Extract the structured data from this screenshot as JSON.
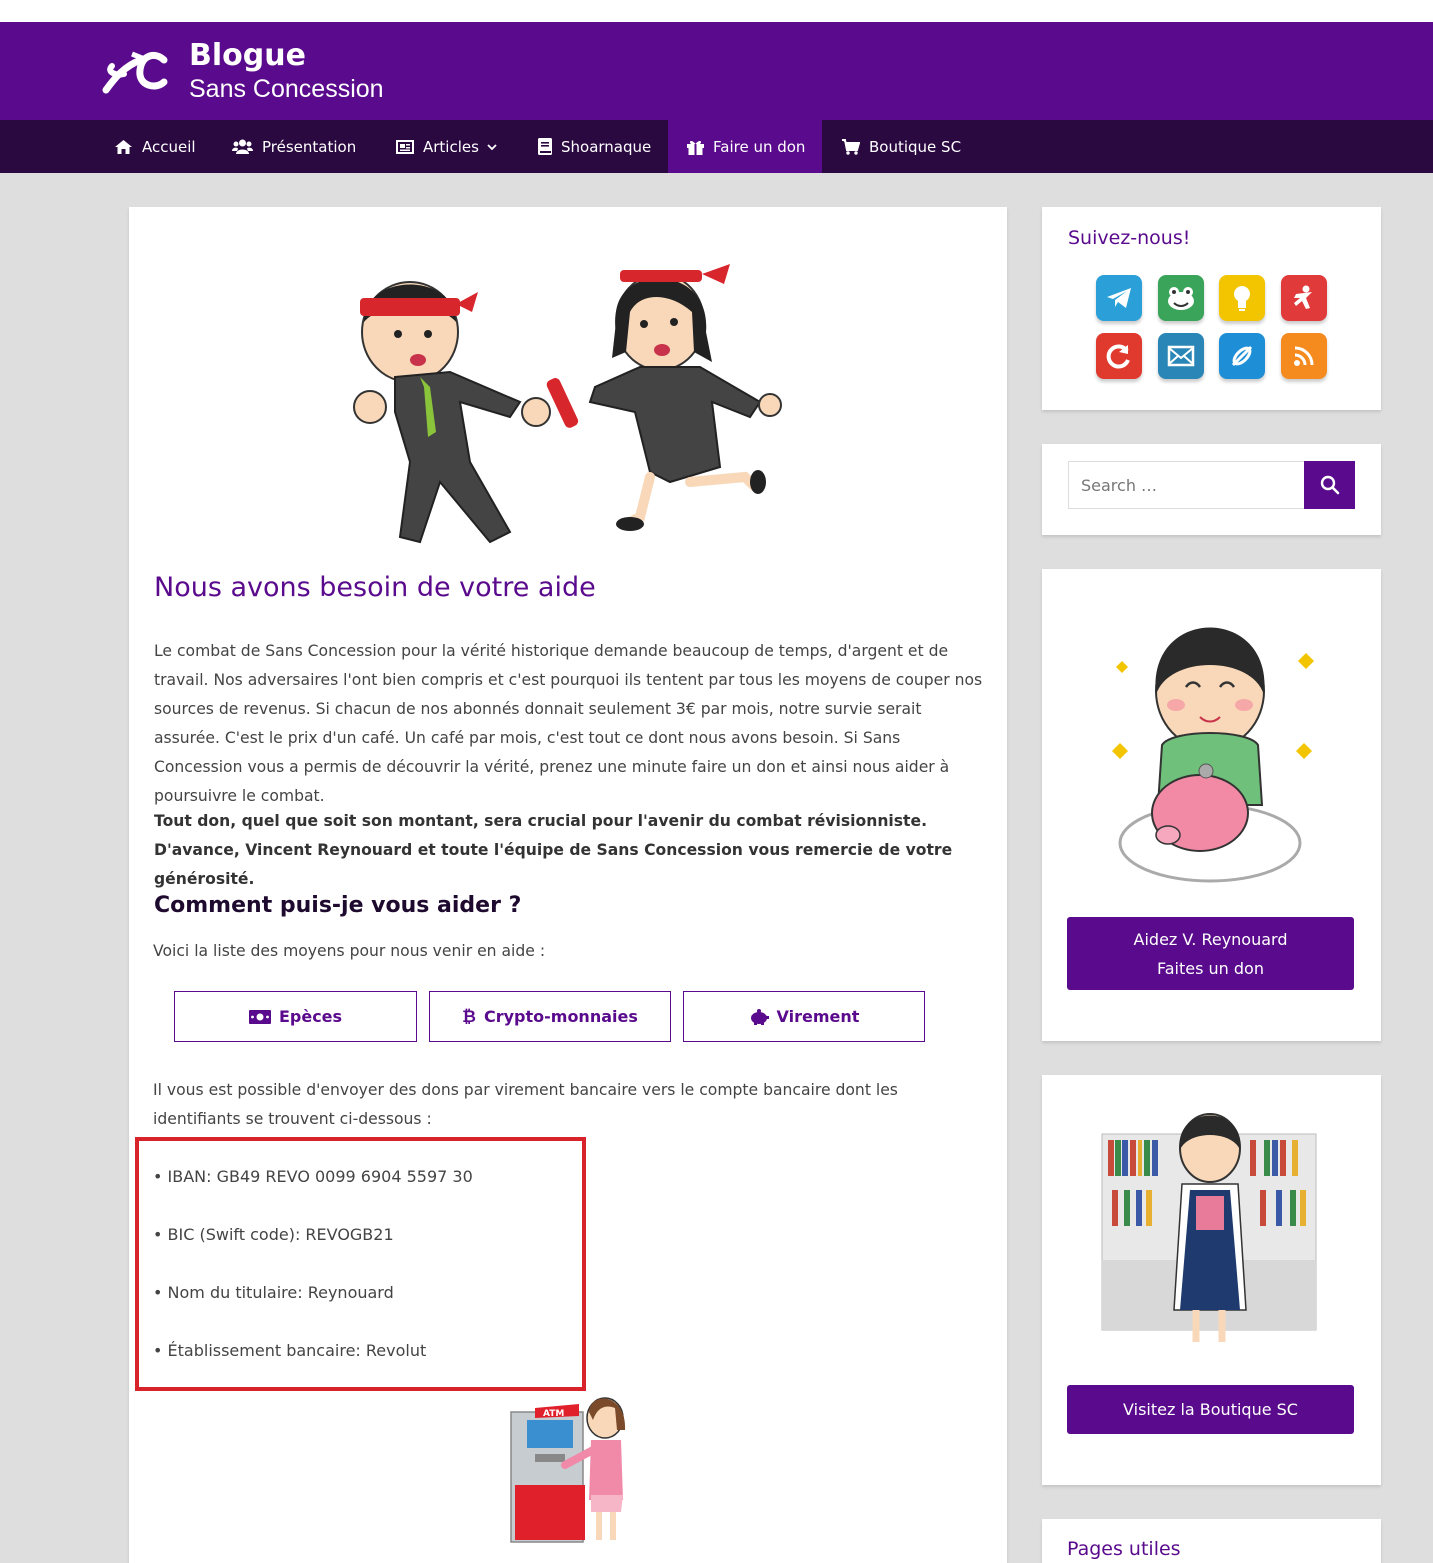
{
  "site": {
    "title": "Blogue",
    "subtitle": "Sans Concession",
    "logo_text": "SC"
  },
  "nav": [
    {
      "label": "Accueil",
      "icon": "home-icon"
    },
    {
      "label": "Présentation",
      "icon": "users-icon"
    },
    {
      "label": "Articles",
      "icon": "newspaper-icon"
    },
    {
      "label": "Shoarnaque",
      "icon": "book-icon"
    },
    {
      "label": "Faire un don",
      "icon": "gift-icon",
      "active": true
    },
    {
      "label": "Boutique SC",
      "icon": "cart-icon"
    }
  ],
  "main": {
    "heading": "Nous avons besoin de votre aide",
    "paragraph": "Le combat de Sans Concession pour la vérité historique demande beaucoup de temps, d'argent et de travail. Nos adversaires l'ont bien compris et c'est pourquoi ils tentent par tous les moyens de couper nos sources de revenus. Si chacun de nos abonnés donnait seulement 3€ par mois, notre survie serait assurée. C'est le prix d'un café. Un café par mois, c'est tout ce dont nous avons besoin. Si Sans Concession vous a permis de découvrir la vérité, prenez une minute faire un don et ainsi nous aider à poursuivre le combat.",
    "bold_paragraph": "Tout don, quel que soit son montant, sera crucial pour l'avenir du combat révisionniste. D'avance, Vincent Reynouard et toute l'équipe de Sans Concession vous remercie de votre générosité.",
    "subheading": "Comment puis-je vous aider ?",
    "intro": "Voici la liste des moyens pour nous venir en aide :",
    "buttons": [
      "Epèces",
      "Crypto-monnaies",
      "Virement"
    ],
    "transfer_text": "Il vous est possible d'envoyer des dons par virement bancaire vers le compte bancaire dont les identifiants se trouvent ci-dessous :",
    "bank": [
      "• IBAN: GB49 REVO 0099 6904 5597 30",
      "• BIC (Swift code): REVOGB21",
      "• Nom du titulaire: Reynouard",
      "• Établissement bancaire: Revolut"
    ],
    "atm_label": "ATM"
  },
  "sidebar": {
    "follow_title": "Suivez-nous!",
    "social": [
      {
        "name": "telegram-icon",
        "color": "#2a9fd8"
      },
      {
        "name": "frog-icon",
        "color": "#3aa55a"
      },
      {
        "name": "lightbulb-icon",
        "color": "#f2c500"
      },
      {
        "name": "gab-icon",
        "color": "#e03a3a"
      },
      {
        "name": "refresh-icon",
        "color": "#e03a2e"
      },
      {
        "name": "mail-icon",
        "color": "#2a86b6"
      },
      {
        "name": "link-icon",
        "color": "#1e8fd6"
      },
      {
        "name": "rss-icon",
        "color": "#f58a1f"
      }
    ],
    "search_placeholder": "Search …",
    "donate_line1": "Aidez V. Reynouard",
    "donate_line2": "Faites un don",
    "shop_button": "Visitez la Boutique SC",
    "pages_title": "Pages utiles"
  },
  "colors": {
    "brand": "#5a0a8c",
    "nav_dark": "#2a0840",
    "highlight": "#d9232a"
  }
}
